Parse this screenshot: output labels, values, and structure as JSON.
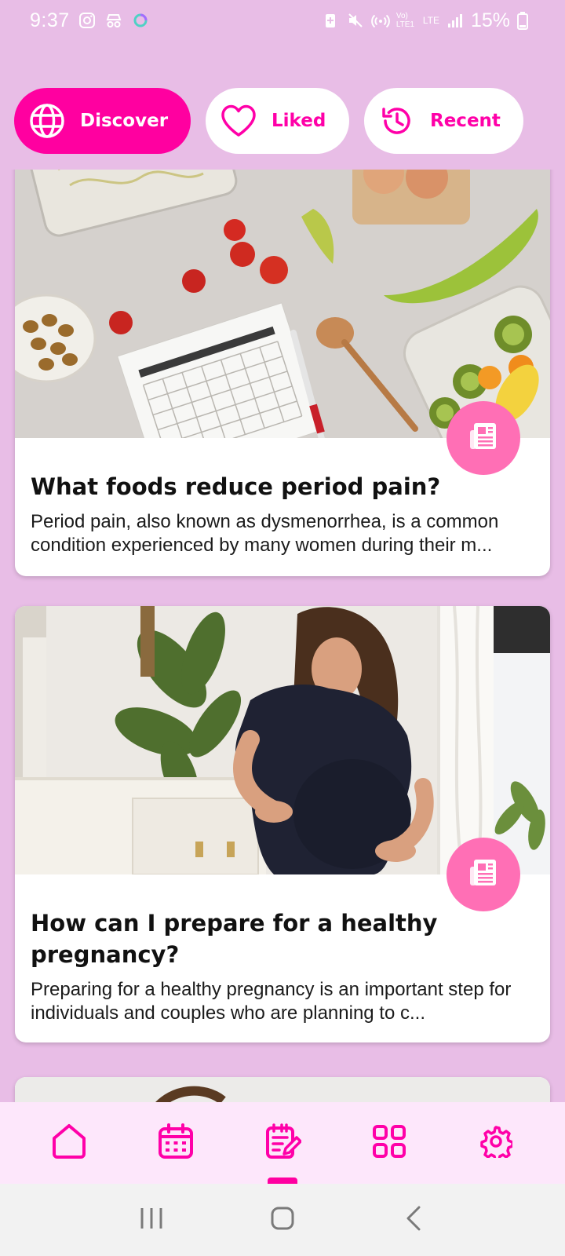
{
  "status_bar": {
    "time": "9:37",
    "battery": "15%",
    "icons": [
      "instagram-icon",
      "incognito-icon",
      "loading-icon",
      "battery-saver-icon",
      "mute-icon",
      "hotspot-icon",
      "volte-icon",
      "lte-icon",
      "signal-icon",
      "battery-icon"
    ],
    "volte_label": "Vo) LTE1",
    "lte_label": "LTE"
  },
  "tabs": [
    {
      "label": "Discover",
      "icon": "globe-icon",
      "active": true
    },
    {
      "label": "Liked",
      "icon": "heart-icon",
      "active": false
    },
    {
      "label": "Recent",
      "icon": "history-icon",
      "active": false
    }
  ],
  "articles": [
    {
      "title": "What foods reduce period pain?",
      "description": "Period pain, also known as dysmenorrhea, is a common condition experienced by many women during their m...",
      "badge_icon": "article-icon"
    },
    {
      "title": "How can I prepare for a healthy pregnancy?",
      "description": "Preparing for a healthy pregnancy is an important step for individuals and couples who are planning to c...",
      "badge_icon": "article-icon"
    }
  ],
  "bottom_nav": [
    {
      "icon": "home-icon"
    },
    {
      "icon": "calendar-icon"
    },
    {
      "icon": "notes-icon",
      "active": true
    },
    {
      "icon": "grid-icon"
    },
    {
      "icon": "settings-icon"
    }
  ],
  "colors": {
    "background": "#e8bde6",
    "accent": "#ff00a0",
    "badge": "#ff6fb5",
    "nav_background": "#fde7fb"
  }
}
